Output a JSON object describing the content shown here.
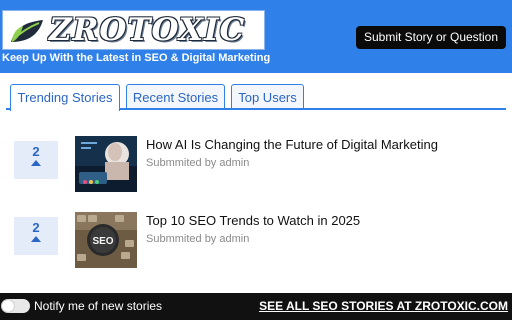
{
  "header": {
    "logo_text": "ZROTOXIC",
    "tagline": "Keep Up With the Latest in SEO & Digital Marketing",
    "submit_label": "Submit Story or Question",
    "colors": {
      "bar": "#2f80e8",
      "button": "#0a0a0a"
    }
  },
  "tabs": [
    {
      "label": "Trending Stories",
      "active": true
    },
    {
      "label": "Recent Stories",
      "active": false
    },
    {
      "label": "Top Users",
      "active": false
    }
  ],
  "stories": [
    {
      "votes": "2",
      "title": "How AI Is Changing the Future of Digital Marketing",
      "meta": "Submmited by admin",
      "thumb_icon": "ai-marketing-image"
    },
    {
      "votes": "2",
      "title": "Top 10 SEO Trends to Watch in 2025",
      "meta": "Submmited by admin",
      "thumb_icon": "seo-keyboard-image"
    }
  ],
  "footer": {
    "notify_label": "Notify me of new stories",
    "see_all_label": "SEE ALL SEO STORIES AT ZROTOXIC.COM"
  }
}
